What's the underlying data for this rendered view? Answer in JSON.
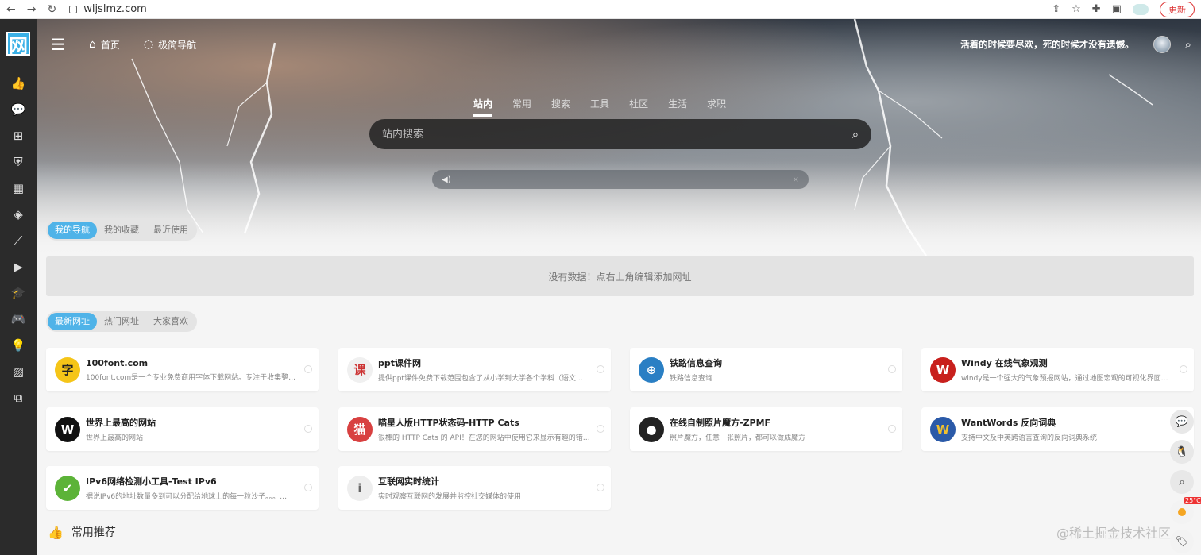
{
  "browser": {
    "url": "wljslmz.com",
    "update_label": "更新"
  },
  "logo": {
    "text": "网"
  },
  "sidebar": {
    "icons": [
      "thumbs-up-icon",
      "chat-icon",
      "grid-icon",
      "shield-icon",
      "calendar-icon",
      "diamond-icon",
      "chart-icon",
      "play-icon",
      "graduation-icon",
      "gamepad-icon",
      "bulb-icon",
      "image-icon",
      "copy-icon"
    ]
  },
  "topbar": {
    "home_label": "首页",
    "nav_label": "极简导航",
    "slogan": "活着的时候要尽欢，死的时候才没有遗憾。"
  },
  "search": {
    "tabs": [
      "站内",
      "常用",
      "搜索",
      "工具",
      "社区",
      "生活",
      "求职"
    ],
    "active_tab": 0,
    "placeholder": "站内搜索"
  },
  "my_nav": {
    "tabs": [
      "我的导航",
      "我的收藏",
      "最近使用"
    ],
    "empty_text": "没有数据！点右上角编辑添加网址"
  },
  "latest": {
    "tabs": [
      "最新网址",
      "热门网址",
      "大家喜欢"
    ]
  },
  "cards": [
    {
      "title": "100font.com",
      "desc": "100font.com是一个专业免费商用字体下载网站。专注于收集整…",
      "icon_char": "字",
      "color": "#f5c518",
      "fg": "#222"
    },
    {
      "title": "ppt课件网",
      "desc": "提供ppt课件免费下载范围包含了从小学到大学各个学科（语文…",
      "icon_char": "课",
      "color": "#f0f0f0",
      "fg": "#c33"
    },
    {
      "title": "铁路信息查询",
      "desc": "铁路信息查询",
      "icon_char": "⊕",
      "color": "#2a7fc4",
      "fg": "#fff"
    },
    {
      "title": "Windy 在线气象观测",
      "desc": "windy是一个强大的气象预报网站，通过地图宏观的可视化界面…",
      "icon_char": "W",
      "color": "#c8201d",
      "fg": "#fff"
    },
    {
      "title": "世界上最高的网站",
      "desc": "世界上最高的网站",
      "icon_char": "W",
      "color": "#111",
      "fg": "#fff"
    },
    {
      "title": "喵星人版HTTP状态码-HTTP Cats",
      "desc": "很棒的 HTTP Cats 的 API！在您的网站中使用它来显示有趣的错…",
      "icon_char": "猫",
      "color": "#d84040",
      "fg": "#fff"
    },
    {
      "title": "在线自制照片魔方-ZPMF",
      "desc": "照片魔方，任意一张照片，都可以做成魔方",
      "icon_char": "●",
      "color": "#222",
      "fg": "#fff"
    },
    {
      "title": "WantWords 反向词典",
      "desc": "支持中文及中英跨语言查询的反向词典系统",
      "icon_char": "W",
      "color": "#2b5aa8",
      "fg": "#f0c030"
    },
    {
      "title": "IPv6网络检测小工具-Test IPv6",
      "desc": "据说IPv6的地址数量多到可以分配给地球上的每一粒沙子。。。…",
      "icon_char": "✔",
      "color": "#5cb338",
      "fg": "#fff"
    },
    {
      "title": "互联网实时统计",
      "desc": "实时观察互联网的发展并监控社交媒体的使用",
      "icon_char": "i",
      "color": "#eee",
      "fg": "#666"
    }
  ],
  "section": {
    "title": "常用推荐"
  },
  "weather": {
    "temp": "25°C"
  },
  "watermark": "@稀土掘金技术社区"
}
